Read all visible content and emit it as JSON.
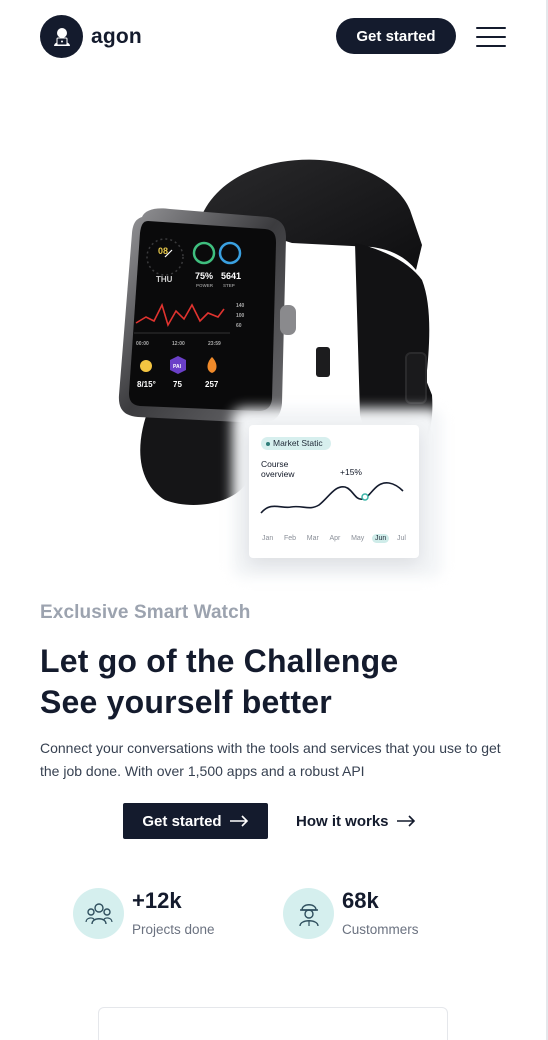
{
  "header": {
    "logo_text": "agon",
    "cta_label": "Get started",
    "menu_icon": "hamburger-menu-icon"
  },
  "hero": {
    "product_image": "smartwatch",
    "watch_screen": {
      "time": "08",
      "day": "THU",
      "power": "75%",
      "power_label": "POWER",
      "steps": "5641",
      "steps_label": "STEP",
      "weather": "8/15°",
      "pai": "75",
      "calories": "257"
    },
    "market_card": {
      "badge": "Market Static",
      "title": "Course overview",
      "change": "+15%",
      "months": [
        "Jan",
        "Feb",
        "Mar",
        "Apr",
        "May",
        "Jun",
        "Jul"
      ],
      "active_month": "Jun"
    },
    "eyebrow": "Exclusive Smart Watch",
    "headline_line1": "Let go of the Challenge",
    "headline_line2": "See yourself better",
    "description": "Connect your conversations with the tools and services that you use to get the job done. With over 1,500 apps and a robust API",
    "primary_cta": "Get started",
    "secondary_cta": "How it works"
  },
  "stats": [
    {
      "value": "+12k",
      "label": "Projects done",
      "icon": "team-icon"
    },
    {
      "value": "68k",
      "label": "Custommers",
      "icon": "worker-icon"
    }
  ],
  "colors": {
    "primary": "#141b2d",
    "accent_soft": "#d5efee",
    "muted_text": "#9ca3af"
  }
}
